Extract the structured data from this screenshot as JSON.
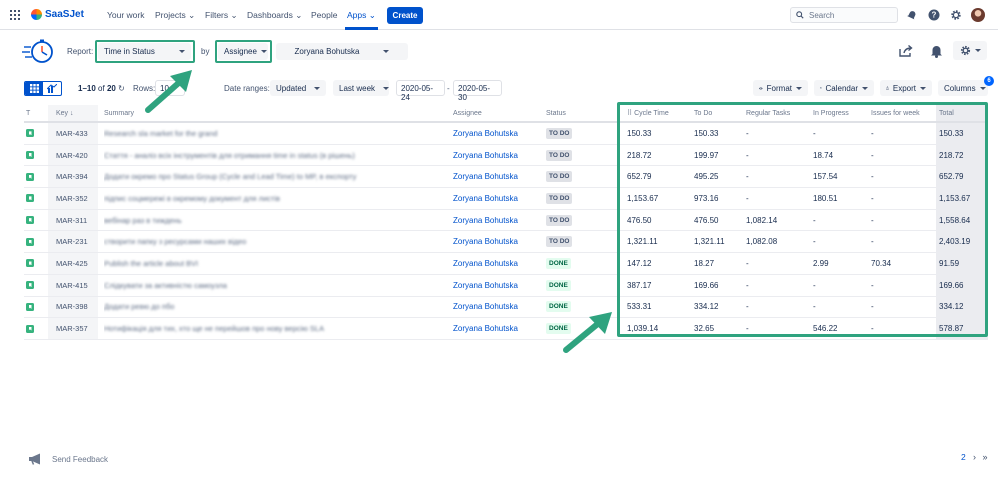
{
  "topnav": {
    "brand": "SaaSJet",
    "items": [
      "Your work",
      "Projects",
      "Filters",
      "Dashboards",
      "People",
      "Apps"
    ],
    "create_label": "Create",
    "search_placeholder": "Search"
  },
  "report": {
    "report_label": "Report:",
    "report_value": "Time in Status",
    "by_label": "by",
    "group_value": "Assignee",
    "user_value": "Zoryana Bohutska"
  },
  "toolbar": {
    "range": "1–10",
    "of_label": "of",
    "total": "20",
    "rows_label": "Rows:",
    "rows_value": "10",
    "date_ranges_label": "Date ranges:",
    "date_field": "Updated",
    "period": "Last week",
    "date_from": "2020-05-24",
    "date_sep": "-",
    "date_to": "2020-05-30",
    "format_label": "Format",
    "calendar_label": "Calendar",
    "export_label": "Export",
    "columns_label": "Columns",
    "columns_badge": "6"
  },
  "table": {
    "headers": [
      "T",
      "Key",
      "Summary",
      "Assignee",
      "Status",
      "Cycle Time",
      "To Do",
      "Regular Tasks",
      "In Progress",
      "Issues for week",
      "Total"
    ],
    "rows": [
      {
        "key": "MAR-433",
        "summary": "Research sla market for the grand",
        "assignee": "Zoryana Bohutska",
        "status": "TO DO",
        "cycle": "150.33",
        "todo": "150.33",
        "regular": "-",
        "progress": "-",
        "issues": "-",
        "total": "150.33"
      },
      {
        "key": "MAR-420",
        "summary": "Стаття - аналіз всіх інструментів для отримання time in status (в рішень)",
        "assignee": "Zoryana Bohutska",
        "status": "TO DO",
        "cycle": "218.72",
        "todo": "199.97",
        "regular": "-",
        "progress": "18.74",
        "issues": "-",
        "total": "218.72"
      },
      {
        "key": "MAR-394",
        "summary": "Додати окремо про Status Group (Cycle and Lead Time) to MP, в експорту",
        "assignee": "Zoryana Bohutska",
        "status": "TO DO",
        "cycle": "652.79",
        "todo": "495.25",
        "regular": "-",
        "progress": "157.54",
        "issues": "-",
        "total": "652.79"
      },
      {
        "key": "MAR-352",
        "summary": "підпис соцмережі в окремому документ для листів",
        "assignee": "Zoryana Bohutska",
        "status": "TO DO",
        "cycle": "1,153.67",
        "todo": "973.16",
        "regular": "-",
        "progress": "180.51",
        "issues": "-",
        "total": "1,153.67"
      },
      {
        "key": "MAR-311",
        "summary": "вебінар раз в тиждень",
        "assignee": "Zoryana Bohutska",
        "status": "TO DO",
        "cycle": "476.50",
        "todo": "476.50",
        "regular": "1,082.14",
        "progress": "-",
        "issues": "-",
        "total": "1,558.64"
      },
      {
        "key": "MAR-231",
        "summary": "створити папку з ресурсами наших відео",
        "assignee": "Zoryana Bohutska",
        "status": "TO DO",
        "cycle": "1,321.11",
        "todo": "1,321.11",
        "regular": "1,082.08",
        "progress": "-",
        "issues": "-",
        "total": "2,403.19"
      },
      {
        "key": "MAR-425",
        "summary": "Publish the article about BVI",
        "assignee": "Zoryana Bohutska",
        "status": "DONE",
        "cycle": "147.12",
        "todo": "18.27",
        "regular": "-",
        "progress": "2.99",
        "issues": "70.34",
        "total": "91.59"
      },
      {
        "key": "MAR-415",
        "summary": "Слідкувати за активністю самоузла",
        "assignee": "Zoryana Bohutska",
        "status": "DONE",
        "cycle": "387.17",
        "todo": "169.66",
        "regular": "-",
        "progress": "-",
        "issues": "-",
        "total": "169.66"
      },
      {
        "key": "MAR-398",
        "summary": "Додати ревю до пбо",
        "assignee": "Zoryana Bohutska",
        "status": "DONE",
        "cycle": "533.31",
        "todo": "334.12",
        "regular": "-",
        "progress": "-",
        "issues": "-",
        "total": "334.12"
      },
      {
        "key": "MAR-357",
        "summary": "Нотифікація для тих, хто ще не перейшов про нову версію SLA",
        "assignee": "Zoryana Bohutska",
        "status": "DONE",
        "cycle": "1,039.14",
        "todo": "32.65",
        "regular": "-",
        "progress": "546.22",
        "issues": "-",
        "total": "578.87"
      }
    ]
  },
  "footer": {
    "feedback_label": "Send Feedback",
    "page": "2",
    "next": "›  »"
  },
  "colors": {
    "accent": "#0052cc",
    "highlight": "#2fa37f",
    "story": "#36b37e"
  }
}
